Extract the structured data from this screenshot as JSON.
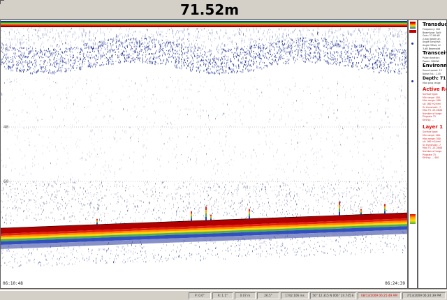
{
  "header": {
    "depth_title": "71.52m"
  },
  "echogram": {
    "depth_lines": [
      "40",
      "60"
    ],
    "start_time": "06:10:48",
    "end_time": "06:24:39",
    "colors": {
      "surface_band": [
        "#0a2a8a",
        "#20a040",
        "#ffd000",
        "#e02020",
        "#900000"
      ],
      "bottom_red": "#b00000",
      "plankton_blue": "#1a2a8a"
    }
  },
  "info_panel": {
    "transducer": {
      "heading": "Transduc",
      "lines": [
        "Frequency: 200",
        "Beamtype: Split",
        "Gain: 27.00 dB",
        "2-way beam an",
        "Angle Sensitivit",
        "Angle Offset, Al",
        "3-dB Beamwidt"
      ]
    },
    "transceiver": {
      "heading": "Transceiv",
      "lines": [
        "Pulse duration:",
        "Power: 2000W"
      ]
    },
    "environment": {
      "heading": "Environm",
      "lines": [
        "Sound speed: 15",
        "Noise Est.: -145"
      ]
    },
    "depth_line": "Depth: 71",
    "max_ping": "Max ping range",
    "active_region": {
      "heading": "Active Re",
      "lines": [
        "Surface type:",
        "Min range: 400.",
        "Max range: 000",
        "sA: 160 m2/nmi",
        "Sv threshold: -7",
        "Max TS -23.28d8",
        "Number of targe",
        "Pingrate 75",
        "Ktning: ..."
      ]
    },
    "layer1": {
      "heading": "Layer 1",
      "lines": [
        "Surface type:",
        "Min range: 400.",
        "Max range: 000",
        "sA: 160 m2/nmi",
        "Sv threshold: -7",
        "Max TS -23.28d8",
        "Number of targe",
        "Pingrate 75",
        "Ktning: ... 400"
      ]
    }
  },
  "status_bar": {
    "cells": [
      {
        "text": "P: 0.0°",
        "red": false
      },
      {
        "text": "R: 1.1°",
        "red": false
      },
      {
        "text": "0.07 m",
        "red": false
      },
      {
        "text": "26.5°",
        "red": false
      },
      {
        "text": "1742.106 ms",
        "red": false
      },
      {
        "text": "56° 12.315 N  006° 24.745 E",
        "red": false
      },
      {
        "text": "08/13/2009 06:25:49 AM",
        "red": true
      },
      {
        "text": "7/13/2009 06:24:39 PM",
        "red": false
      }
    ]
  }
}
